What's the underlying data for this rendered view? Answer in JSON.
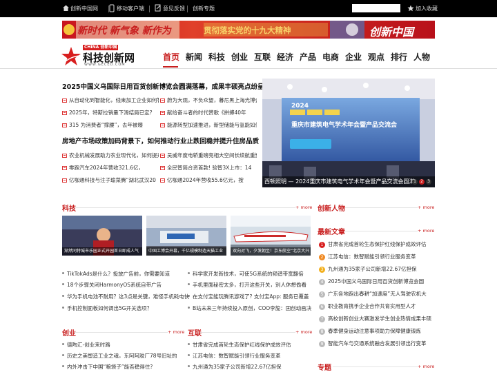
{
  "topbar": {
    "home": "创新中国网",
    "mobile": "移动客户端",
    "feedback": "意见反馈",
    "topics": "创新专题",
    "favorite": "加入收藏"
  },
  "banner": {
    "left_text": "新时代 新气象 新作为",
    "middle_text": "贯彻落实党的十九大精神",
    "right_text": "创新中国"
  },
  "logo": {
    "china": "CHINA",
    "cn": "创新中国",
    "main": "科技创新网",
    "url": "WWW.GECEO.COM"
  },
  "nav": [
    "首页",
    "新闻",
    "科技",
    "创业",
    "互联",
    "经济",
    "产品",
    "电商",
    "企业",
    "观点",
    "排行",
    "人物"
  ],
  "top_news": {
    "headline1": "2025中国义乌国际日用百货创新博览会圆满落幕，成果丰硕亮点纷呈",
    "group1": [
      [
        "从自动化到智能化，线束加工企业如何智",
        "蔚为大观，不负众望，暮尼黑上海光博会"
      ],
      [
        "2025年，特斯拉销量下滑结局已定?",
        "献给奋斗者的时代赞歌《拼搏40年"
      ],
      [
        "315 为消费者“撑腰”，去年被曝",
        "能源转型加速推进，新型储能与氢能如何"
      ]
    ],
    "headline2": "房地产市场政策加码背景下，如何推动行业止跌回稳并提升住房品质",
    "group2": [
      [
        "农业机械发展助力农业现代化，如何提升",
        "吴威年度电轿重磅亮相大空间长续航重塑"
      ],
      [
        "零跑汽车2024年营收321.6亿，",
        "全民智简合资首款! 验智3X上市：14"
      ],
      [
        "亿咖通科技与注子瑜菜腾“湖北武汉20",
        "亿咖通2024年营收55.6亿元，按"
      ]
    ]
  },
  "hero": {
    "slide_title": "重庆市建筑电气学术年会暨产品交流会",
    "slide_year": "2024",
    "caption": "西顿照明 — 2024重庆市建筑电气学术年会暨产品交流会圆满",
    "dots": [
      "1",
      "2",
      "3"
    ]
  },
  "sections": {
    "tech": "科技",
    "people": "创新人物",
    "latest": "最新文章",
    "startup": "创业",
    "internet": "互联",
    "topics": "专题",
    "more": "+ more"
  },
  "tech_thumbs": [
    "渐然同特城市乐园正式开园首日即成人气",
    "中国工博会开幕，千亿规模制造天猫工业",
    "双向对飞，夕发朝至！京东航空“北京大兴"
  ],
  "tech_list": [
    [
      "TikTokAds是什么？投放广告前，你需要知道",
      "科学家开发新技术，可使5G系统的频谱带宽翻倍"
    ],
    [
      "18个步骤关闭HarmonyOS系统自带广告",
      "手机里面秘密太多，打开这些开关，别人休想偷看"
    ],
    [
      "华为手机电池不耐用？这3点是关键，难怪手机耗电快",
      "在支付宝能玩腾讯游戏了? 支付宝App: 服务已覆盖"
    ],
    [
      "手机控制面板如何调出5G开关选项？",
      "B站未来三年持续投入原创，COO李旎：国创动画决"
    ]
  ],
  "startup_list": [
    "德陶汇-创业来时路",
    "历史之美塑造工业之魂，东阿阿胶厂78号旧址的",
    "内外冲击下中国“粮袋子”能否稳得住?"
  ],
  "internet_list": [
    "甘肃省完成首轮生态保护红线保护成效评估",
    "江苏电信：数智赋能引领行业服务变革",
    "九州通为35家子公司新增22.67亿担保"
  ],
  "latest_list": [
    "甘肃省完成首轮生态保护红线保护成效评估",
    "江苏电信：数智赋能引领行业服务变革",
    "九州通为35家子公司新增22.67亿担保",
    "2025中国义乌国际日用百货创新博览会圆",
    "广东各地跑出春耕“加速度”无人驾驶农机大",
    "职业教育携手企业合作共育实用型人才",
    "高校创新创业大赛激发学生创业热情成果丰硕",
    "春季健身运动注意事项助力保障健康锻炼",
    "智能汽车与交通系统融合发展引领出行变革"
  ],
  "latest_numbers": [
    "1",
    "2",
    "3",
    "4",
    "5",
    "6",
    "7",
    "8",
    "9"
  ],
  "colors": {
    "brand_red": "#c81e1e",
    "top_black": "#000000"
  }
}
